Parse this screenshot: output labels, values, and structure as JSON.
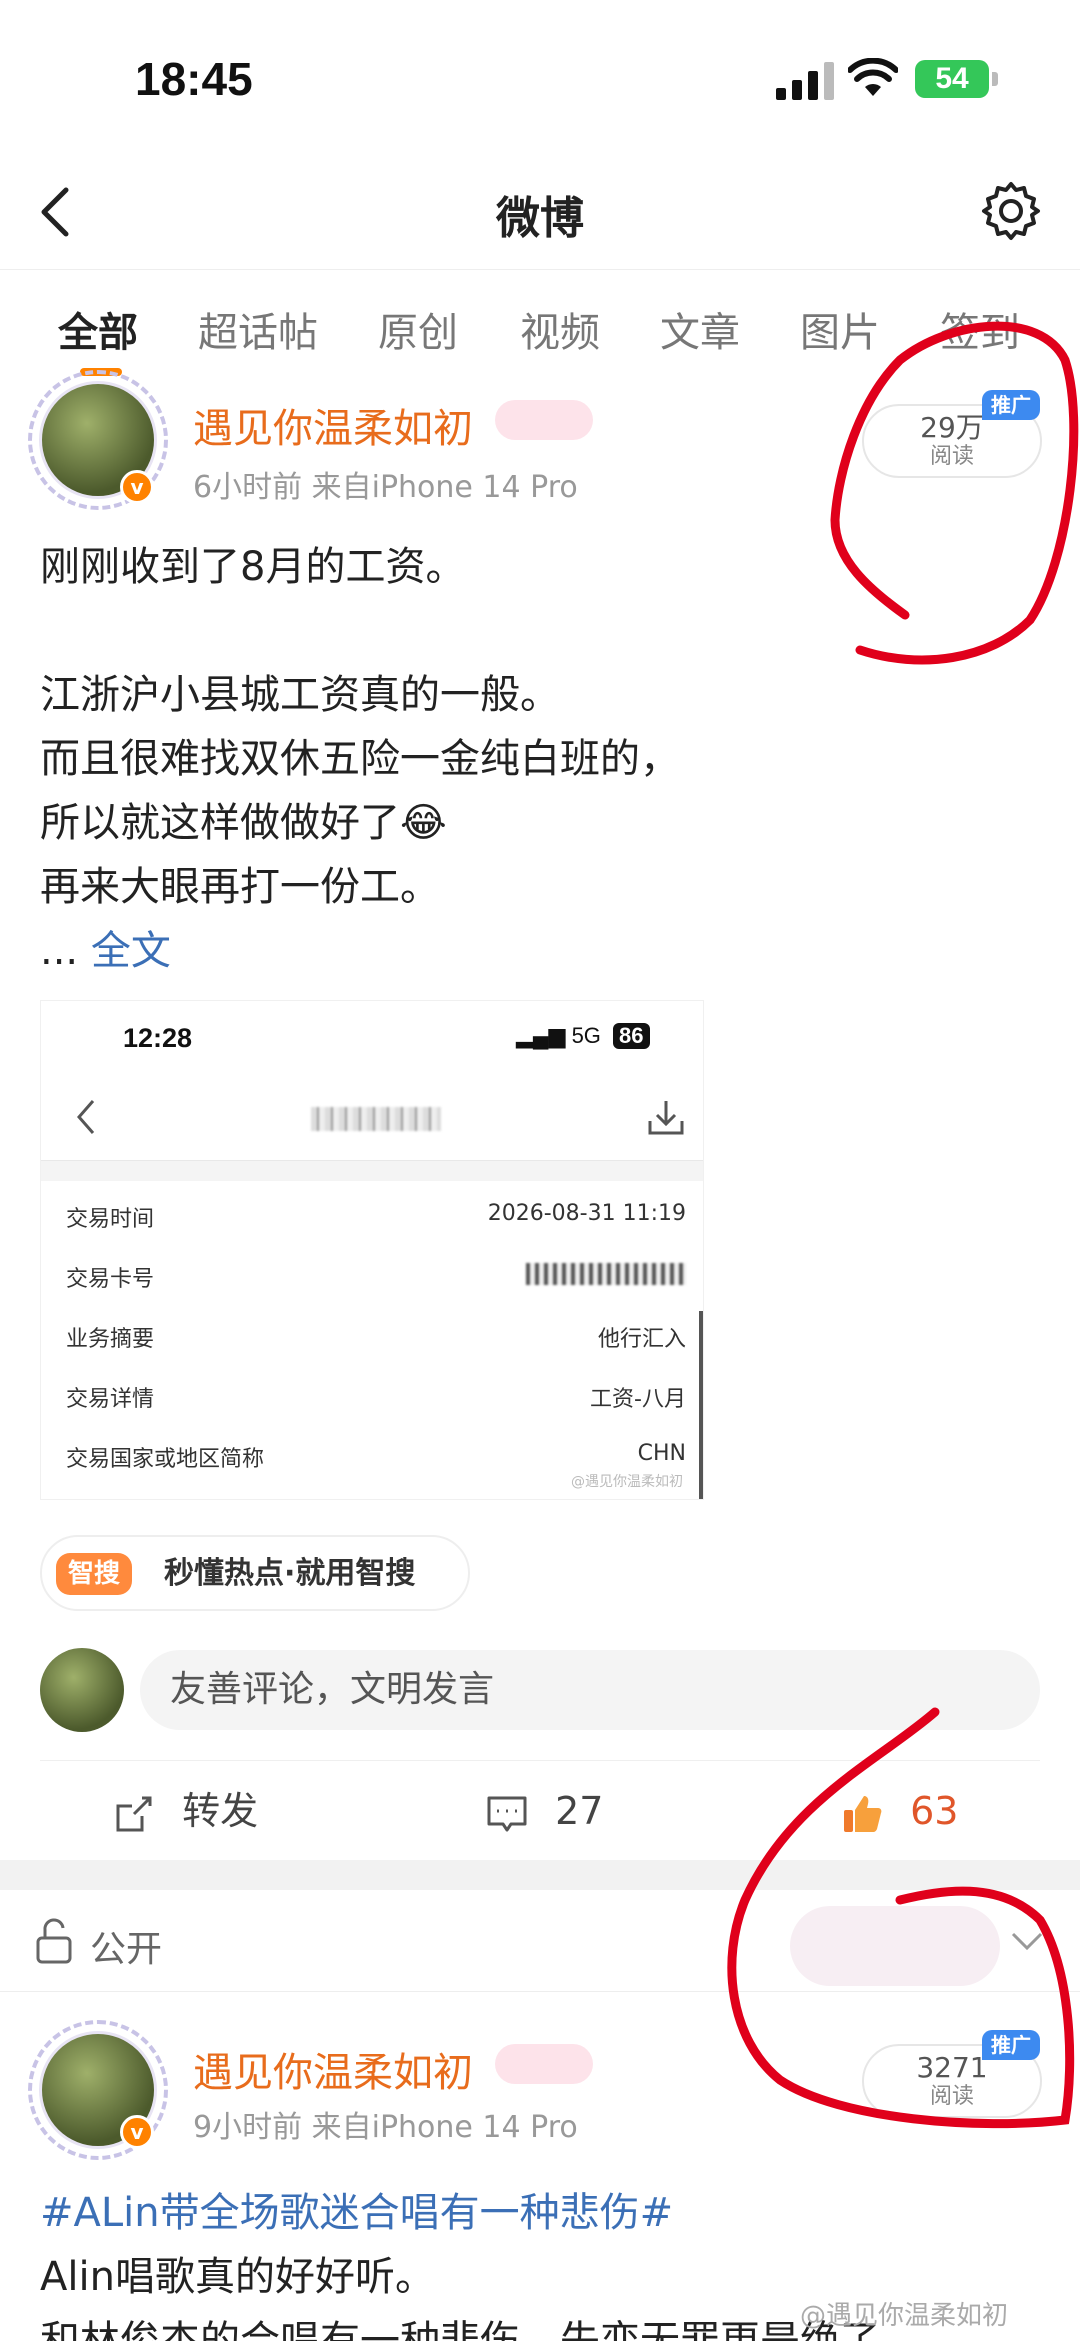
{
  "status_bar": {
    "time": "18:45",
    "battery": "54"
  },
  "nav": {
    "title": "微博"
  },
  "tabs": [
    {
      "label": "全部",
      "active": true
    },
    {
      "label": "超话帖"
    },
    {
      "label": "原创"
    },
    {
      "label": "视频"
    },
    {
      "label": "文章"
    },
    {
      "label": "图片"
    },
    {
      "label": "签到"
    }
  ],
  "post1": {
    "username": "遇见你温柔如初",
    "meta": "6小时前  来自iPhone 14 Pro",
    "read_count": "29万",
    "read_label": "阅读",
    "promo_tag": "推广",
    "lines": [
      "刚刚收到了8月的工资。",
      "",
      "江浙沪小县城工资真的一般。",
      "而且很难找双休五险一金纯白班的，",
      "所以就这样做做好了😂",
      "再来大眼再打一份工。"
    ],
    "ellipsis": "...",
    "fulltext": "全文",
    "embedded": {
      "time": "12:28",
      "network": "5G",
      "battery": "86",
      "rows": [
        {
          "label": "交易时间",
          "value": "2026-08-31 11:19"
        },
        {
          "label": "交易卡号",
          "value": ""
        },
        {
          "label": "业务摘要",
          "value": "他行汇入"
        },
        {
          "label": "交易详情",
          "value": "工资-八月"
        },
        {
          "label": "交易国家或地区简称",
          "value": "CHN"
        }
      ],
      "watermark": "@遇见你温柔如初"
    },
    "smart_search": {
      "tag": "智搜",
      "text": "秒懂热点·就用智搜"
    },
    "comment_placeholder": "友善评论，文明发言",
    "actions": {
      "repost": "转发",
      "comments": "27",
      "likes": "63"
    }
  },
  "visibility": {
    "label": "公开"
  },
  "post2": {
    "username": "遇见你温柔如初",
    "meta": "9小时前  来自iPhone 14 Pro",
    "read_count": "3271",
    "read_label": "阅读",
    "promo_tag": "推广",
    "hashtag": "#ALin带全场歌迷合唱有一种悲伤#",
    "lines": [
      "Alin唱歌真的好好听。",
      "和林俊杰的合唱有一种悲伤，失恋无罪更是绝了"
    ],
    "watermark": "@遇见你温柔如初"
  },
  "colors": {
    "accent": "#ff8200",
    "username": "#e86c1c",
    "link": "#3b6fb6",
    "annotation": "#e0001b"
  }
}
